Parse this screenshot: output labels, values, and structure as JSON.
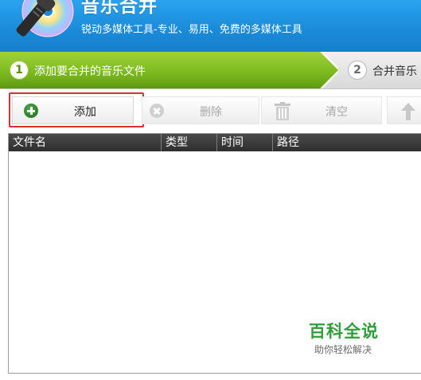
{
  "header": {
    "title": "音乐合并",
    "subtitle": "锐动多媒体工具-专业、易用、免费的多媒体工具"
  },
  "steps": [
    {
      "number": "1",
      "label": "添加要合并的音乐文件",
      "active": true
    },
    {
      "number": "2",
      "label": "合并音乐",
      "active": false
    }
  ],
  "toolbar": {
    "add_label": "添加",
    "delete_label": "删除",
    "clear_label": "清空"
  },
  "table": {
    "columns": [
      "文件名",
      "类型",
      "时间",
      "路径"
    ],
    "rows": []
  },
  "watermark": {
    "title": "百科全说",
    "subtitle": "助你轻松解决"
  },
  "colors": {
    "header_blue": "#1a8ad8",
    "step_active_green": "#7dbb1f",
    "highlight_red": "#d9322e",
    "watermark_green": "#2f9e3a"
  },
  "icons": [
    "app-logo-icon",
    "plus-icon",
    "close-icon",
    "trash-icon",
    "arrow-up-icon"
  ]
}
